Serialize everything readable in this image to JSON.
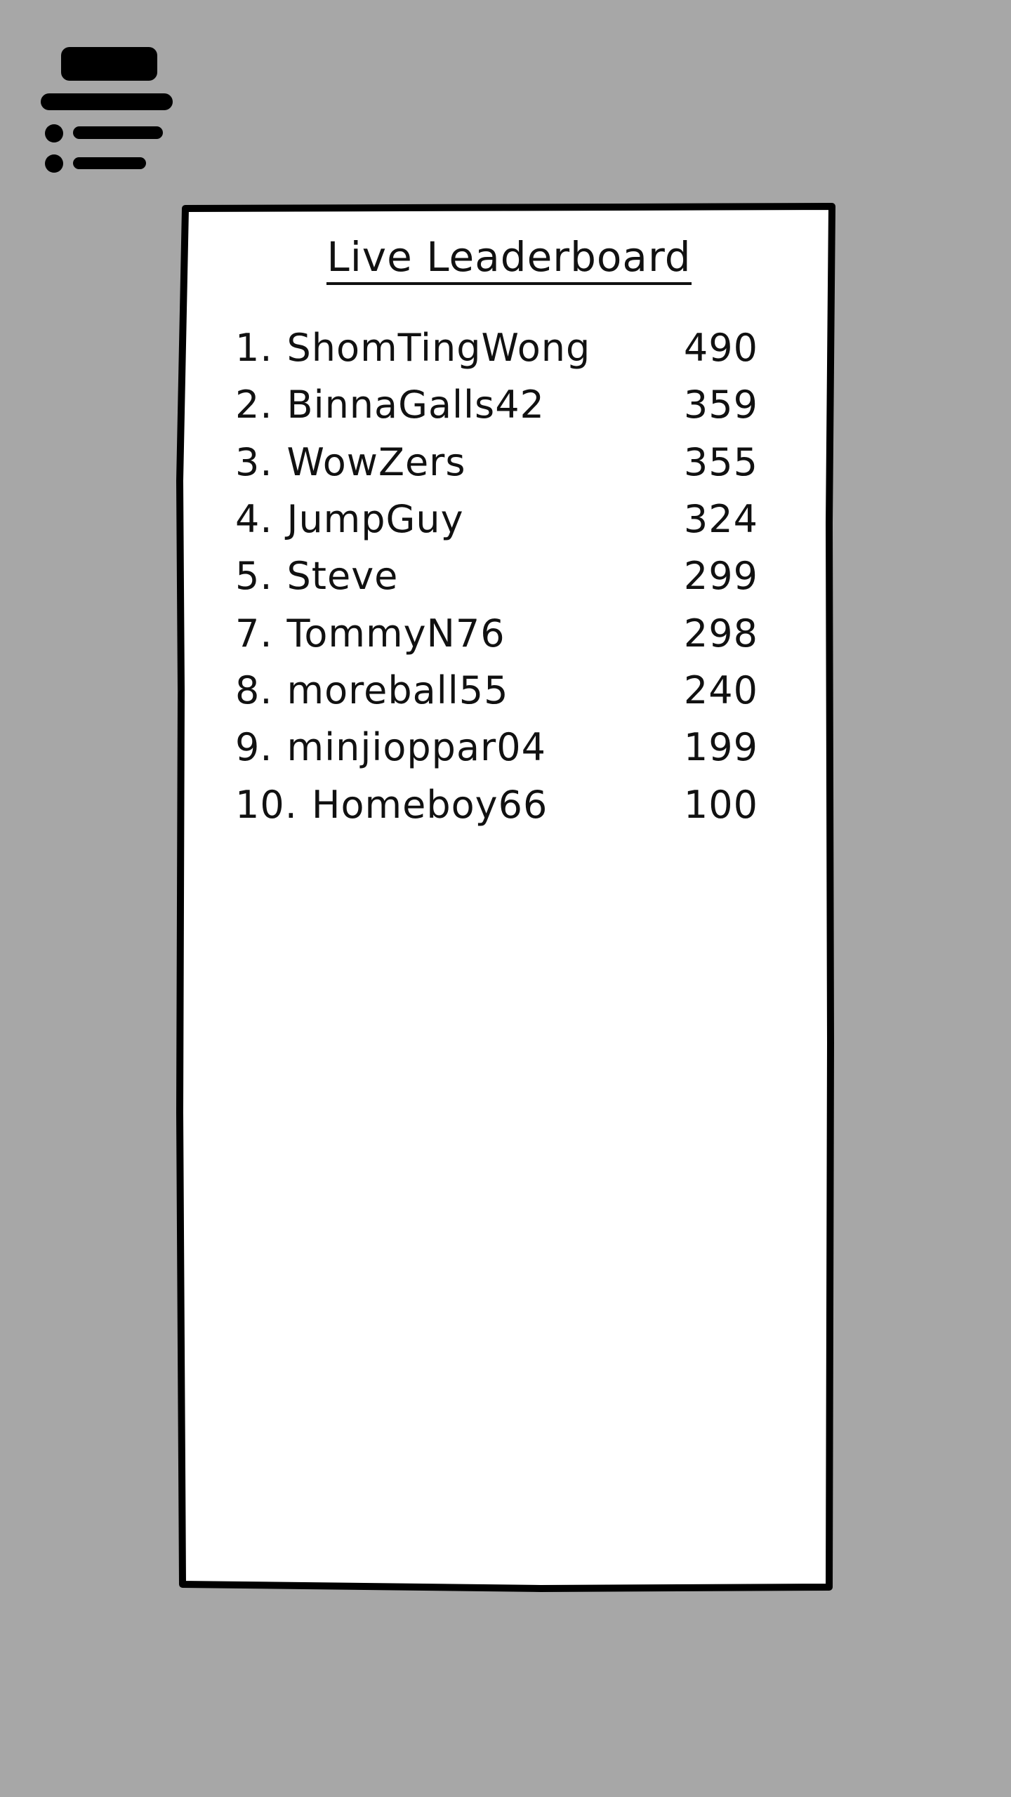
{
  "menu": {
    "icon": "list-menu-icon"
  },
  "leaderboard": {
    "title": "Live Leaderboard",
    "entries": [
      {
        "rank": "1.",
        "name": "ShomTingWong",
        "score": "490"
      },
      {
        "rank": "2.",
        "name": "BinnaGalls42",
        "score": "359"
      },
      {
        "rank": "3.",
        "name": "WowZers",
        "score": "355"
      },
      {
        "rank": "4.",
        "name": "JumpGuy",
        "score": "324"
      },
      {
        "rank": "5.",
        "name": "Steve",
        "score": "299"
      },
      {
        "rank": "7.",
        "name": "TommyN76",
        "score": "298"
      },
      {
        "rank": "8.",
        "name": "moreball55",
        "score": "240"
      },
      {
        "rank": "9.",
        "name": "minjioppar04",
        "score": "199"
      },
      {
        "rank": "10.",
        "name": "Homeboy66",
        "score": "100"
      }
    ]
  },
  "colors": {
    "background": "#a7a7a7",
    "panel": "#ffffff",
    "ink": "#111111"
  }
}
